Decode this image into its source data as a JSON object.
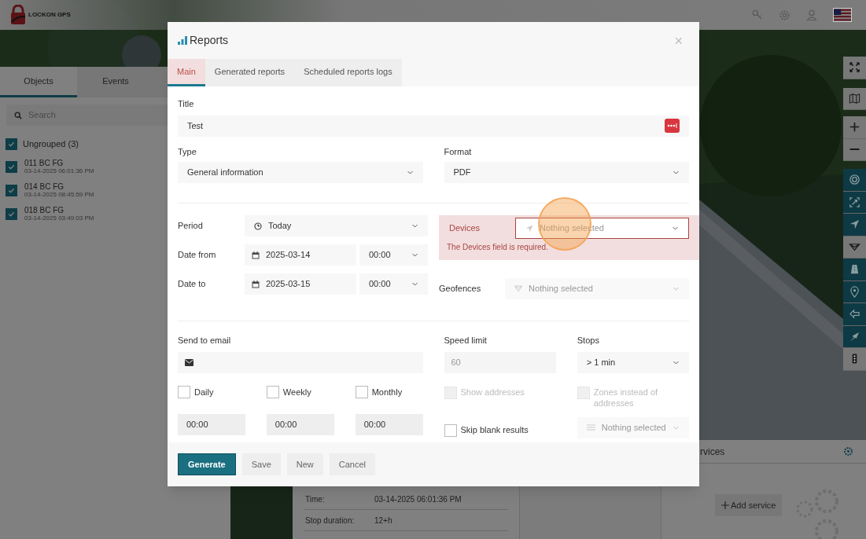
{
  "app": {
    "logo_text": "LOCKON GPS"
  },
  "sidebar": {
    "tabs": [
      {
        "label": "Objects",
        "selected": true
      },
      {
        "label": "Events",
        "selected": false
      }
    ],
    "search": {
      "placeholder": "Search"
    },
    "group": {
      "label": "Ungrouped (3)",
      "checked": true
    },
    "objects": [
      {
        "name": "011 BC FG",
        "time": "03-14-2025 06:01:36 PM",
        "checked": true
      },
      {
        "name": "014 BC FG",
        "time": "03-14-2025 08:45:59 PM",
        "checked": true
      },
      {
        "name": "018 BC FG",
        "time": "03-14-2025 03:49:03 PM",
        "checked": true
      }
    ]
  },
  "map_controls": [
    {
      "kind": "fullscreen",
      "active": false
    },
    {
      "kind": "map",
      "active": false
    },
    {
      "kind": "zoom_in",
      "active": false
    },
    {
      "kind": "zoom_out",
      "active": false
    },
    {
      "kind": "target",
      "active": true
    },
    {
      "kind": "fit",
      "active": true
    },
    {
      "kind": "navigate",
      "active": true
    },
    {
      "kind": "filter",
      "active": false
    },
    {
      "kind": "road",
      "active": true
    },
    {
      "kind": "pin",
      "active": true
    },
    {
      "kind": "back",
      "active": true
    },
    {
      "kind": "pointer",
      "active": true
    },
    {
      "kind": "traffic",
      "active": false
    }
  ],
  "info_panel": {
    "rows": [
      {
        "label": "Time:",
        "value": "03-14-2025 06:01:36 PM"
      },
      {
        "label": "Stop duration:",
        "value": "12+h"
      }
    ]
  },
  "services_panel": {
    "title": "rvices",
    "add_button": "Add service"
  },
  "modal": {
    "title": "Reports",
    "close": "×",
    "tabs": [
      {
        "label": "Main",
        "selected": true
      },
      {
        "label": "Generated reports",
        "selected": false
      },
      {
        "label": "Scheduled reports logs",
        "selected": false
      }
    ],
    "title_field": {
      "label": "Title",
      "value": "Test"
    },
    "type": {
      "label": "Type",
      "value": "General information"
    },
    "format": {
      "label": "Format",
      "value": "PDF"
    },
    "period": {
      "label": "Period",
      "value": "Today"
    },
    "date_from": {
      "label": "Date from",
      "date": "2025-03-14",
      "time": "00:00"
    },
    "date_to": {
      "label": "Date to",
      "date": "2025-03-15",
      "time": "00:00"
    },
    "devices": {
      "label": "Devices",
      "placeholder": "Nothing selected",
      "error": "The Devices field is required."
    },
    "geofences": {
      "label": "Geofences",
      "placeholder": "Nothing selected",
      "disabled": true
    },
    "send_to_email": {
      "label": "Send to email"
    },
    "schedule": [
      {
        "label": "Daily",
        "checked": false,
        "time": "00:00"
      },
      {
        "label": "Weekly",
        "checked": false,
        "time": "00:00"
      },
      {
        "label": "Monthly",
        "checked": false,
        "time": "00:00"
      }
    ],
    "speed_limit": {
      "label": "Speed limit",
      "placeholder": "60",
      "disabled": true
    },
    "stops": {
      "label": "Stops",
      "value": "> 1 min"
    },
    "options": [
      {
        "label": "Show addresses",
        "checked": false,
        "disabled": true
      },
      {
        "label": "Zones instead of addresses",
        "checked": false,
        "disabled": true
      },
      {
        "label": "Skip blank results",
        "checked": false,
        "disabled": false
      }
    ],
    "zones_select": {
      "placeholder": "Nothing selected",
      "disabled": true
    },
    "buttons": [
      {
        "label": "Generate",
        "kind": "primary"
      },
      {
        "label": "Save",
        "kind": "secondary"
      },
      {
        "label": "New",
        "kind": "secondary"
      },
      {
        "label": "Cancel",
        "kind": "secondary"
      }
    ]
  }
}
